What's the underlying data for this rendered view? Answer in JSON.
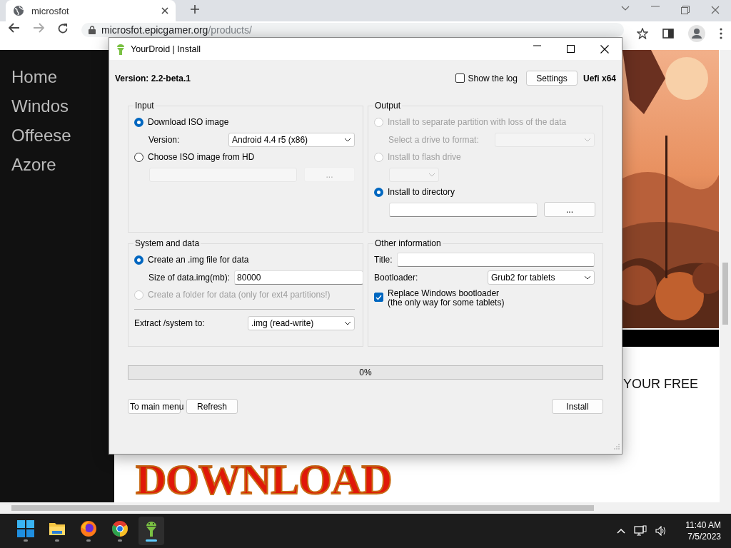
{
  "browser": {
    "tab": {
      "title": "microsfot",
      "selected": true
    },
    "address": {
      "host": "microsfot.epicgamer.org",
      "path": "/products/"
    }
  },
  "page": {
    "nav": [
      {
        "label": "Home"
      },
      {
        "label": "Windos"
      },
      {
        "label": "Offeese"
      },
      {
        "label": "Azore"
      }
    ],
    "banner_text": "YOUR FREE",
    "headline": "DOWNLOAD"
  },
  "dialog": {
    "title": "YourDroid | Install",
    "version": "Version: 2.2-beta.1",
    "show_log": {
      "label": "Show the log",
      "checked": false
    },
    "settings_button": "Settings",
    "mode": "Uefi x64",
    "groups": [
      {
        "title": "Input",
        "rows": [
          {
            "kind": "radio",
            "label": "Download ISO image",
            "selected": true,
            "disabled": false
          },
          {
            "kind": "select",
            "label": "Version:",
            "value": "Android 4.4 r5 (x86)",
            "disabled": false
          },
          {
            "kind": "radio",
            "label": "Choose ISO image from HD",
            "selected": false,
            "disabled": false
          },
          {
            "kind": "path",
            "button": "...",
            "disabled": true
          }
        ]
      },
      {
        "title": "Output",
        "rows": [
          {
            "kind": "radio",
            "label": "Install to separate partition with loss of the data",
            "selected": false,
            "disabled": true
          },
          {
            "kind": "select",
            "label": "Select a drive to format:",
            "disabled": true
          },
          {
            "kind": "radio",
            "label": "Install to flash drive",
            "selected": false,
            "disabled": true
          },
          {
            "kind": "select",
            "disabled": true
          },
          {
            "kind": "radio",
            "label": "Install to directory",
            "selected": true,
            "disabled": false
          },
          {
            "kind": "path",
            "button": "...",
            "disabled": false
          }
        ]
      },
      {
        "title": "System and data",
        "rows": [
          {
            "kind": "radio",
            "label": "Create an .img file for data",
            "selected": true,
            "disabled": false
          },
          {
            "kind": "text",
            "label": "Size of data.img(mb):",
            "value": "80000"
          },
          {
            "kind": "radio",
            "label": "Create a folder for data (only for ext4 partitions!)",
            "selected": false,
            "disabled": true
          },
          {
            "kind": "rule"
          },
          {
            "kind": "select",
            "label": "Extract /system to:",
            "value": ".img (read-write)",
            "disabled": false
          }
        ]
      },
      {
        "title": "Other information",
        "rows": [
          {
            "kind": "text",
            "label": "Title:"
          },
          {
            "kind": "select",
            "label": "Bootloader:",
            "value": "Grub2 for tablets",
            "disabled": false
          },
          {
            "kind": "check",
            "label": "Replace Windows bootloader\n(the only way for some tablets)",
            "checked": true
          }
        ]
      }
    ],
    "progress": {
      "level": 0,
      "text": "0%"
    },
    "buttons_left": [
      "To main menu",
      "Refresh"
    ],
    "button_right": "Install"
  },
  "taskbar": {
    "apps": [
      {
        "kind": "start",
        "active": false
      },
      {
        "kind": "folder",
        "active": false
      },
      {
        "kind": "firefox",
        "active": false
      },
      {
        "kind": "chrome",
        "active": false
      },
      {
        "kind": "yourdroid",
        "active": true
      }
    ],
    "time": "11:40 AM",
    "date": "7/5/2023"
  }
}
